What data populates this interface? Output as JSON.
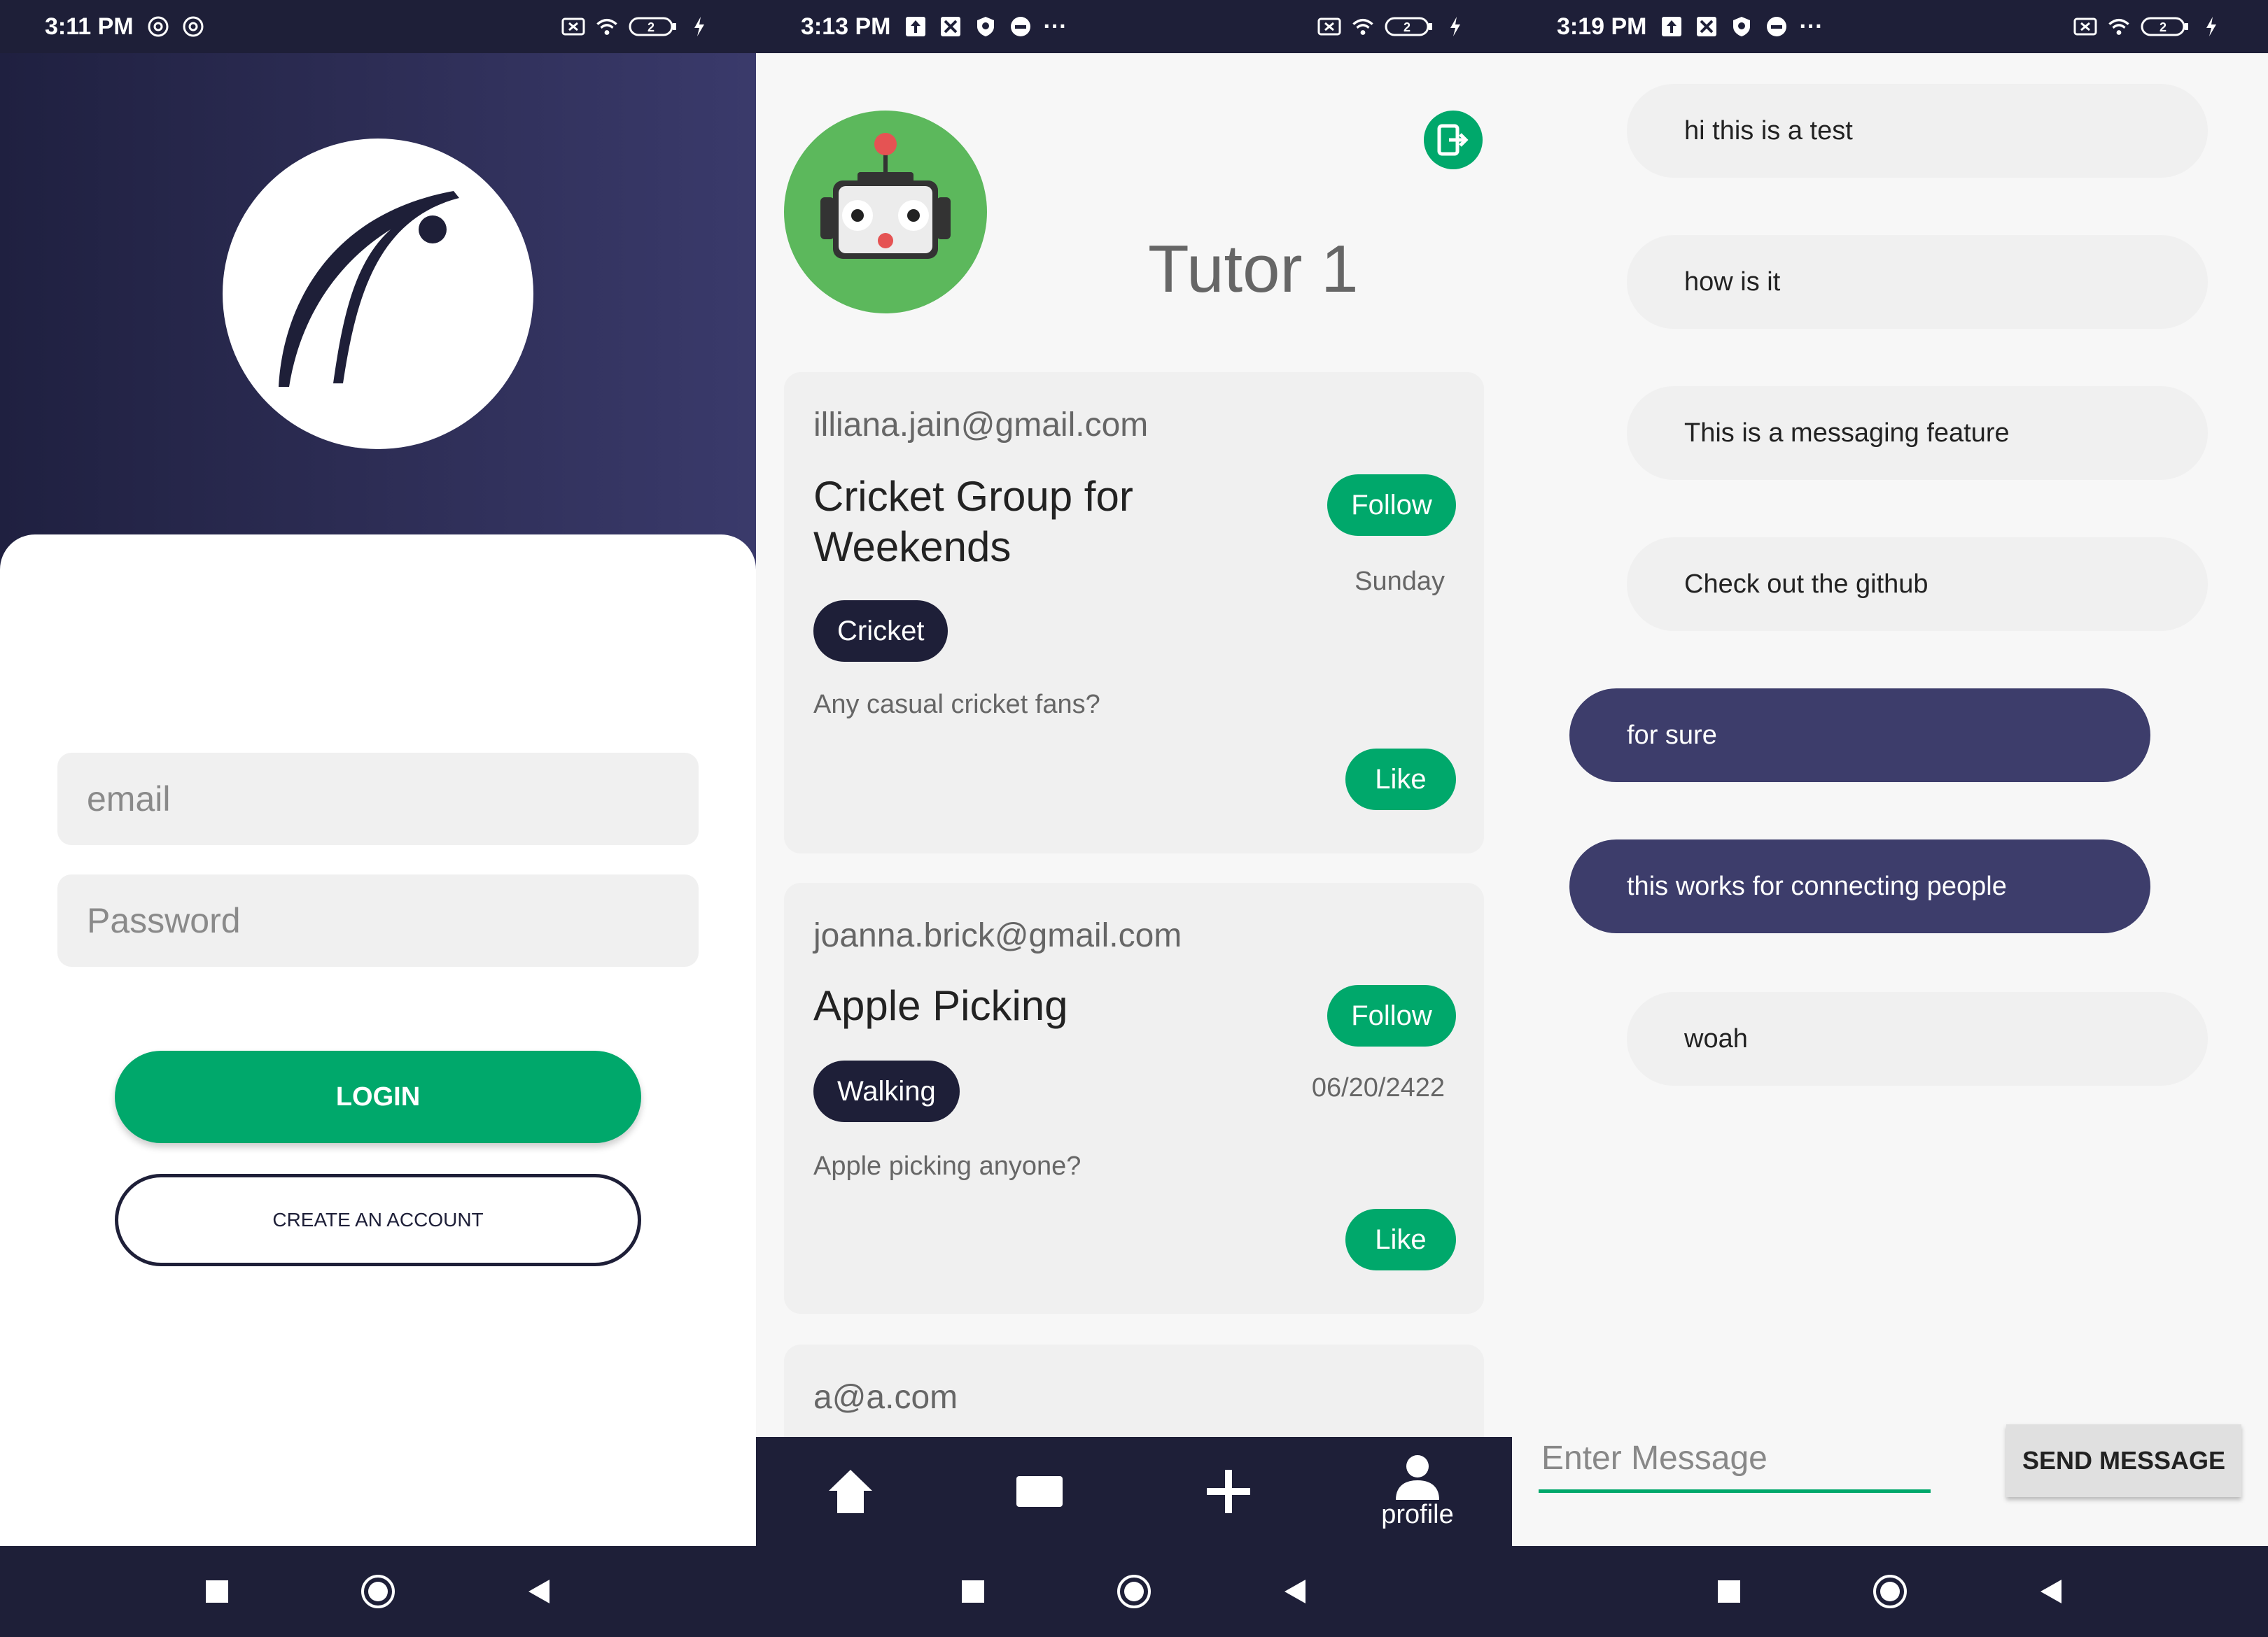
{
  "colors": {
    "primary_dark": "#1e1f38",
    "accent_green": "#00a86b",
    "outgoing_bubble": "#3d3d6b",
    "avatar_green": "#5cb85c"
  },
  "screens": [
    {
      "status": {
        "time": "3:11 PM",
        "battery": "2"
      },
      "login": {
        "email_placeholder": "email",
        "password_placeholder": "Password",
        "login_label": "LOGIN",
        "create_account_label": "CREATE AN ACCOUNT"
      }
    },
    {
      "status": {
        "time": "3:13 PM",
        "battery": "2",
        "more": "···"
      },
      "profile": {
        "name": "Tutor 1",
        "avatar_icon": "robot-icon",
        "logout_icon": "logout-icon"
      },
      "posts": [
        {
          "email": "illiana.jain@gmail.com",
          "title_line1": "Cricket Group for",
          "title_line2": "Weekends",
          "follow_label": "Follow",
          "date": "Sunday",
          "tag": "Cricket",
          "description": "Any casual cricket fans?",
          "like_label": "Like"
        },
        {
          "email": "joanna.brick@gmail.com",
          "title_line1": "Apple Picking",
          "title_line2": "",
          "follow_label": "Follow",
          "date": "06/20/2422",
          "tag": "Walking",
          "description": "Apple picking anyone?",
          "like_label": "Like"
        },
        {
          "email": "a@a.com"
        }
      ],
      "bottom_nav": {
        "items": [
          {
            "icon": "home-icon",
            "label": ""
          },
          {
            "icon": "message-icon",
            "label": ""
          },
          {
            "icon": "add-icon",
            "label": ""
          },
          {
            "icon": "profile-icon",
            "label": "profile"
          }
        ]
      }
    },
    {
      "status": {
        "time": "3:19 PM",
        "battery": "2",
        "more": "···"
      },
      "chat": {
        "messages": [
          {
            "text": "hi this is a test",
            "direction": "incoming"
          },
          {
            "text": "how is it",
            "direction": "incoming"
          },
          {
            "text": "This is a messaging feature",
            "direction": "incoming"
          },
          {
            "text": "Check out the github",
            "direction": "incoming"
          },
          {
            "text": "for sure",
            "direction": "outgoing"
          },
          {
            "text": "this works for connecting people",
            "direction": "outgoing"
          },
          {
            "text": "woah",
            "direction": "incoming"
          }
        ],
        "input_placeholder": "Enter Message",
        "send_label": "SEND MESSAGE"
      }
    }
  ]
}
